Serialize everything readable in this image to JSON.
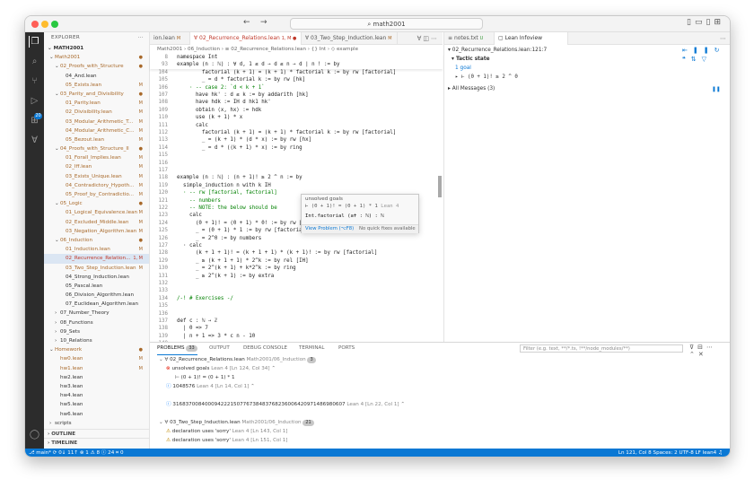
{
  "window": {
    "search": "math2001",
    "nav_back": "←",
    "nav_fwd": "→"
  },
  "activity": {
    "explorer_icon": "files-icon",
    "badge": "20"
  },
  "sidebar": {
    "title": "EXPLORER",
    "root": "MATH2001",
    "items": [
      {
        "label": "Math2001",
        "badge": "●"
      },
      {
        "label": "02_Proofs_with_Structure",
        "badge": "●"
      },
      {
        "label": "04_And.lean",
        "badge": ""
      },
      {
        "label": "05_Exists.lean",
        "badge": "M"
      },
      {
        "label": "03_Parity_and_Divisibility",
        "badge": "●"
      },
      {
        "label": "01_Parity.lean",
        "badge": "M"
      },
      {
        "label": "02_Divisibility.lean",
        "badge": "M"
      },
      {
        "label": "03_Modular_Arithmetic_T...",
        "badge": "M"
      },
      {
        "label": "04_Modular_Arithmetic_C...",
        "badge": "M"
      },
      {
        "label": "05_Bezout.lean",
        "badge": "M"
      },
      {
        "label": "04_Proofs_with_Structure_II",
        "badge": "●"
      },
      {
        "label": "01_Forall_Implies.lean",
        "badge": "M"
      },
      {
        "label": "02_Iff.lean",
        "badge": "M"
      },
      {
        "label": "03_Exists_Unique.lean",
        "badge": "M"
      },
      {
        "label": "04_Contradictory_Hypoth...",
        "badge": "M"
      },
      {
        "label": "05_Proof_by_Contradictio...",
        "badge": "M"
      },
      {
        "label": "05_Logic",
        "badge": "●"
      },
      {
        "label": "01_Logical_Equivalence.lean",
        "badge": "M"
      },
      {
        "label": "02_Excluded_Middle.lean",
        "badge": "M"
      },
      {
        "label": "03_Negation_Algorithm.lean",
        "badge": "M"
      },
      {
        "label": "06_Induction",
        "badge": "●"
      },
      {
        "label": "01_Induction.lean",
        "badge": "M"
      },
      {
        "label": "02_Recurrence_Relation...",
        "badge": "1, M"
      },
      {
        "label": "03_Two_Step_Induction.lean",
        "badge": "M"
      },
      {
        "label": "04_Strong_Induction.lean",
        "badge": ""
      },
      {
        "label": "05_Pascal.lean",
        "badge": ""
      },
      {
        "label": "06_Division_Algorithm.lean",
        "badge": ""
      },
      {
        "label": "07_Euclidean_Algorithm.lean",
        "badge": ""
      },
      {
        "label": "07_Number_Theory",
        "badge": ""
      },
      {
        "label": "08_Functions",
        "badge": ""
      },
      {
        "label": "09_Sets",
        "badge": ""
      },
      {
        "label": "10_Relations",
        "badge": ""
      },
      {
        "label": "Homework",
        "badge": "●"
      },
      {
        "label": "hw0.lean",
        "badge": "M"
      },
      {
        "label": "hw1.lean",
        "badge": "M"
      },
      {
        "label": "hw2.lean",
        "badge": ""
      },
      {
        "label": "hw3.lean",
        "badge": ""
      },
      {
        "label": "hw4.lean",
        "badge": ""
      },
      {
        "label": "hw5.lean",
        "badge": ""
      },
      {
        "label": "hw6.lean",
        "badge": ""
      },
      {
        "label": "scripts",
        "badge": ""
      }
    ],
    "outline": "OUTLINE",
    "timeline": "TIMELINE"
  },
  "editor": {
    "tabs": [
      {
        "label": "ion.lean",
        "mod": "M"
      },
      {
        "label": "02_Recurrence_Relations.lean",
        "mod": "1, M ●"
      },
      {
        "label": "03_Two_Step_Induction.lean",
        "mod": "M"
      }
    ],
    "breadcrumbs": "Math2001 › 06_Induction › ≡ 02_Recurrence_Relations.lean › {} Int › ◇ example",
    "sticky": [
      {
        "n": "8",
        "t": "namespace Int"
      },
      {
        "n": "93",
        "t": "example (n : ℕ) : ∀ d, 1 ≤ d → d ≤ n → d ∣ n ! := by"
      }
    ],
    "lines": [
      {
        "n": "104",
        "t": "        factorial (k + 1) = (k + 1) * factorial k := by rw [factorial]"
      },
      {
        "n": "105",
        "t": "        _ = d * factorial k := by rw [hk]"
      },
      {
        "n": "106",
        "t": "    · -- case 2: `d < k + 1`"
      },
      {
        "n": "107",
        "t": "      have hk' : d ≤ k := by addarith [hk]"
      },
      {
        "n": "108",
        "t": "      have hdk := IH d hk1 hk'"
      },
      {
        "n": "109",
        "t": "      obtain ⟨x, hx⟩ := hdk"
      },
      {
        "n": "110",
        "t": "      use (k + 1) * x"
      },
      {
        "n": "111",
        "t": "      calc"
      },
      {
        "n": "112",
        "t": "        factorial (k + 1) = (k + 1) * factorial k := by rw [factorial]"
      },
      {
        "n": "113",
        "t": "        _ = (k + 1) * (d * x) := by rw [hx]"
      },
      {
        "n": "114",
        "t": "        _ = d * ((k + 1) * x) := by ring"
      },
      {
        "n": "115",
        "t": ""
      },
      {
        "n": "116",
        "t": ""
      },
      {
        "n": "117",
        "t": ""
      },
      {
        "n": "118",
        "t": "example (n : ℕ) : (n + 1)! ≥ 2 ^ n := by"
      },
      {
        "n": "119",
        "t": "  simple_induction n with k IH"
      },
      {
        "n": "120",
        "t": "  · -- rw [factorial, factorial]"
      },
      {
        "n": "121",
        "t": "    -- numbers"
      },
      {
        "n": "122",
        "t": "    -- NOTE: the below should be                                    reason..."
      },
      {
        "n": "123",
        "t": "    calc"
      },
      {
        "n": "124",
        "t": "      (0 + 1)! = (0 + 1) * 0! := by rw [factorial]"
      },
      {
        "n": "125",
        "t": "      _ = (0 + 1) * 1 := by rw [factorial]"
      },
      {
        "n": "126",
        "t": "      _ = 2^0 := by numbers"
      },
      {
        "n": "127",
        "t": "  · calc"
      },
      {
        "n": "128",
        "t": "      (k + 1 + 1)! = (k + 1 + 1) * (k + 1)! := by rw [factorial]"
      },
      {
        "n": "129",
        "t": "      _ ≥ (k + 1 + 1) * 2^k := by rel [IH]"
      },
      {
        "n": "130",
        "t": "      _ = 2^(k + 1) + k*2^k := by ring"
      },
      {
        "n": "131",
        "t": "      _ ≥ 2^(k + 1) := by extra"
      },
      {
        "n": "132",
        "t": ""
      },
      {
        "n": "133",
        "t": ""
      },
      {
        "n": "134",
        "t": "/-! # Exercises -/"
      },
      {
        "n": "135",
        "t": ""
      },
      {
        "n": "136",
        "t": ""
      },
      {
        "n": "137",
        "t": "def c : ℕ → ℤ"
      },
      {
        "n": "138",
        "t": "  | 0 => 7"
      },
      {
        "n": "139",
        "t": "  | n + 1 => 3 * c n - 10"
      },
      {
        "n": "140",
        "t": ""
      }
    ],
    "hover": {
      "title": "unsolved goals",
      "goal": "⊢ (0 + 1)! = (0 + 1) * 1",
      "goal_src": "Lean 4",
      "type": "Int.factorial (a✝ : ℕ) : ℕ",
      "view_problem": "View Problem (⌥F8)",
      "no_fix": "No quick fixes available"
    }
  },
  "infoview": {
    "tabs": [
      {
        "label": "notes.txt",
        "mod": "U"
      },
      {
        "label": "Lean Infoview",
        "mod": ""
      }
    ],
    "file": "02_Recurrence_Relations.lean:121:7",
    "tactic_state": "Tactic state",
    "goals": "1 goal",
    "goal": "⊢ (0 + 1)! ≥ 2 ^ 0",
    "all_messages": "All Messages (3)",
    "restart": "Restart File"
  },
  "panel": {
    "tabs": [
      {
        "label": "PROBLEMS",
        "count": "33"
      },
      {
        "label": "OUTPUT",
        "count": ""
      },
      {
        "label": "DEBUG CONSOLE",
        "count": ""
      },
      {
        "label": "TERMINAL",
        "count": ""
      },
      {
        "label": "PORTS",
        "count": ""
      }
    ],
    "filter_placeholder": "Filter (e.g. text, **/*.ts, !**/node_modules/**)",
    "rows": [
      {
        "icon": "chevron-down-icon",
        "text": "02_Recurrence_Relations.lean",
        "sub": "Math2001/06_Induction",
        "count": "3"
      },
      {
        "icon": "error-icon",
        "text": "unsolved goals",
        "sub": "Lean 4  [Ln 124, Col 34]",
        "count": ""
      },
      {
        "icon": "",
        "text": "⊢ (0 + 1)! = (0 + 1) * 1",
        "sub": "",
        "count": ""
      },
      {
        "icon": "info-icon",
        "text": "1048576",
        "sub": "Lean 4  [Ln 14, Col 1]",
        "count": ""
      },
      {
        "icon": "",
        "text": "",
        "sub": "",
        "count": ""
      },
      {
        "icon": "info-icon",
        "text": "316837008400094222150776738483768236006420971486980607",
        "sub": "Lean 4  [Ln 22, Col 1]",
        "count": ""
      },
      {
        "icon": "",
        "text": "",
        "sub": "",
        "count": ""
      },
      {
        "icon": "chevron-down-icon",
        "text": "03_Two_Step_Induction.lean",
        "sub": "Math2001/06_Induction",
        "count": "21"
      },
      {
        "icon": "warning-icon",
        "text": "declaration uses 'sorry'",
        "sub": "Lean 4  [Ln 143, Col 1]",
        "count": ""
      },
      {
        "icon": "warning-icon",
        "text": "declaration uses 'sorry'",
        "sub": "Lean 4  [Ln 151, Col 1]",
        "count": ""
      }
    ]
  },
  "status": {
    "left": "⎇ main*  ⟳ 0↓ 11↑   ⊗ 1 ⚠ 8 ⓘ 24    ⌗ 0",
    "right": "Ln 121, Col 8    Spaces: 2    UTF-8    LF    lean4    ♫"
  },
  "colors": {
    "accent": "#0a78d4",
    "error": "#e51400",
    "warning": "#bf8803",
    "info": "#1a85ff",
    "modified": "#a8692a"
  }
}
